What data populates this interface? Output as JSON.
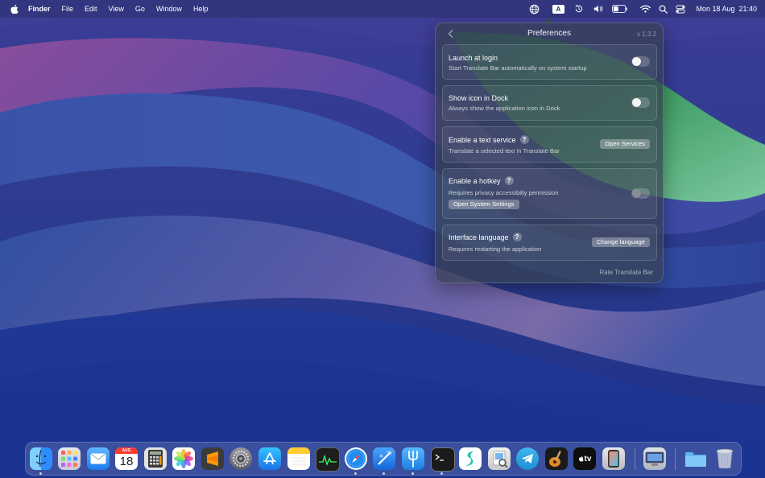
{
  "menubar": {
    "app_name": "Finder",
    "menus": [
      "File",
      "Edit",
      "View",
      "Go",
      "Window",
      "Help"
    ],
    "status_icons": [
      "translate-bar-globe-icon",
      "input-source-icon",
      "time-machine-icon",
      "volume-icon",
      "battery-icon",
      "wifi-icon",
      "spotlight-icon",
      "control-center-icon"
    ],
    "input_source_letter": "A",
    "clock": "Mon 18 Aug  21:40"
  },
  "popover": {
    "title": "Preferences",
    "version": "v 1.3.2",
    "launch_at_login": {
      "title": "Launch at login",
      "subtitle": "Start Translate Bar automatically on system startup",
      "enabled": false
    },
    "show_icon_in_dock": {
      "title": "Show icon in Dock",
      "subtitle": "Always show the application icon in Dock",
      "enabled": false
    },
    "text_service": {
      "title": "Enable a text service",
      "subtitle": "Translate a selected text in Translate Bar",
      "button": "Open Services"
    },
    "hotkey": {
      "title": "Enable a hotkey",
      "subtitle": "Requires privacy accessibilty permission",
      "button": "Open System Settings",
      "enabled": false
    },
    "interface_language": {
      "title": "Interface language",
      "subtitle": "Requires restarting the application",
      "button": "Change language"
    },
    "help_glyph": "?",
    "rate_link": "Rate Translate Bar"
  },
  "dock": {
    "calendar_month": "AUG",
    "calendar_day": "18",
    "apple_tv_label": "tv",
    "items": [
      {
        "name": "finder",
        "running": true
      },
      {
        "name": "launchpad",
        "running": false
      },
      {
        "name": "mail",
        "running": false
      },
      {
        "name": "calendar",
        "running": false
      },
      {
        "name": "calculator",
        "running": false
      },
      {
        "name": "photos",
        "running": false
      },
      {
        "name": "sublime-text",
        "running": false
      },
      {
        "name": "system-settings",
        "running": false
      },
      {
        "name": "app-store",
        "running": false
      },
      {
        "name": "notes",
        "running": false
      },
      {
        "name": "activity-monitor",
        "running": false
      },
      {
        "name": "safari",
        "running": true
      },
      {
        "name": "xcode",
        "running": true
      },
      {
        "name": "fork",
        "running": true
      },
      {
        "name": "terminal",
        "running": true
      },
      {
        "name": "surfshark",
        "running": false
      },
      {
        "name": "preview",
        "running": false
      },
      {
        "name": "telegram",
        "running": false
      },
      {
        "name": "garageband",
        "running": false
      },
      {
        "name": "apple-tv",
        "running": false
      },
      {
        "name": "simulator",
        "running": false
      },
      {
        "name": "screenshot-app",
        "running": false
      },
      {
        "name": "downloads-folder",
        "running": false
      },
      {
        "name": "trash",
        "running": false
      }
    ]
  },
  "colors": {
    "accent_button": "#5c6b7e",
    "wallpaper_purple": "#6a4aa8",
    "wallpaper_blue": "#2f3f94",
    "wallpaper_green": "#3a8a6a"
  }
}
